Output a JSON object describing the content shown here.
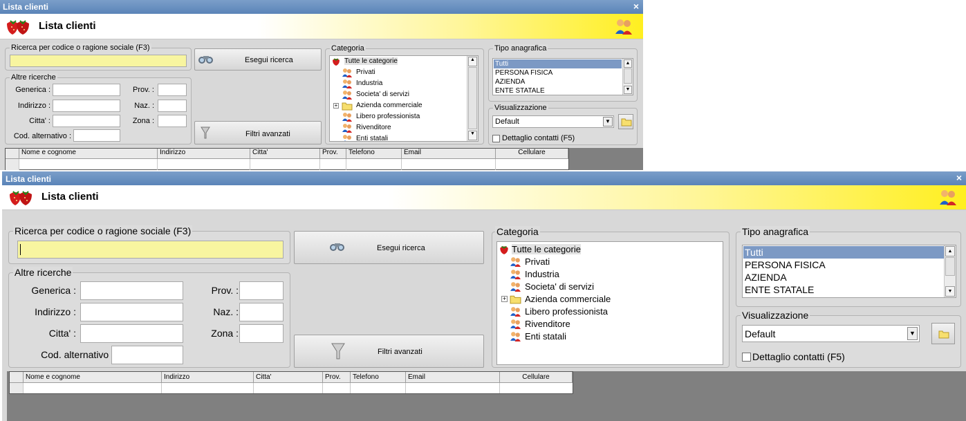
{
  "window": {
    "title": "Lista clienti",
    "close_glyph": "×",
    "header_title": "Lista clienti",
    "logo_icon": "strawberries-icon",
    "user_icon": "users-icon"
  },
  "search": {
    "legend": "Ricerca per codice o ragione sociale (F3)",
    "value": "",
    "execute_label": "Esegui ricerca",
    "execute_icon": "binoculars-icon"
  },
  "other": {
    "legend": "Altre ricerche",
    "generica_label": "Generica :",
    "indirizzo_label": "Indirizzo :",
    "citta_label": "Citta' :",
    "codalt_label": "Cod. alternativo :",
    "prov_label": "Prov. :",
    "naz_label": "Naz. :",
    "zona_label": "Zona :",
    "filters_label": "Filtri avanzati",
    "filters_icon": "funnel-icon"
  },
  "categoria": {
    "legend": "Categoria",
    "items": [
      {
        "label": "Tutte le categorie",
        "icon": "strawberry-icon"
      },
      {
        "label": "Privati",
        "icon": "users-icon"
      },
      {
        "label": "Industria",
        "icon": "users-icon"
      },
      {
        "label": "Societa' di servizi",
        "icon": "users-icon"
      },
      {
        "label": "Azienda commerciale",
        "icon": "folder-icon"
      },
      {
        "label": "Libero professionista",
        "icon": "users-icon"
      },
      {
        "label": "Rivenditore",
        "icon": "users-icon"
      },
      {
        "label": "Enti statali",
        "icon": "users-icon"
      }
    ]
  },
  "tipo": {
    "legend": "Tipo anagrafica",
    "options": [
      "Tutti",
      "PERSONA FISICA",
      "AZIENDA",
      "ENTE STATALE"
    ],
    "selected": "Tutti"
  },
  "visual": {
    "legend": "Visualizzazione",
    "value": "Default",
    "detail_label": "Dettaglio contatti (F5)",
    "detail_checked": false
  },
  "grid": {
    "columns": [
      "Nome e cognome",
      "Indirizzo",
      "Citta'",
      "Prov.",
      "Telefono",
      "Email",
      "Cellulare"
    ]
  },
  "colors": {
    "title_bar": "#5a84b8",
    "header_gradient_end": "#ffef20",
    "search_field": "#f8f5a0",
    "selection": "#7c99c4",
    "grid_area": "#808080"
  }
}
